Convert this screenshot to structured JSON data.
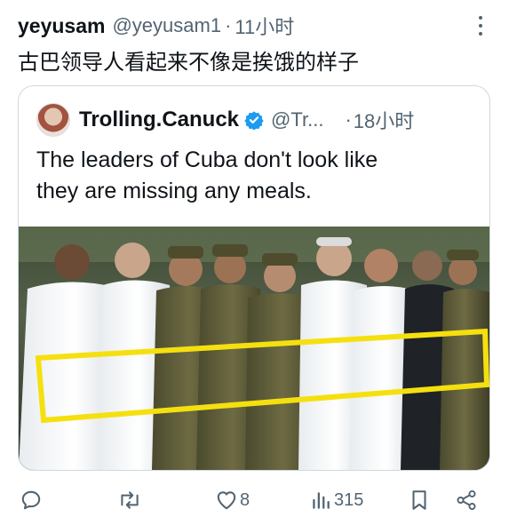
{
  "tweet": {
    "author_name": "yeyusam",
    "author_handle": "@yeyusam1",
    "separator": "·",
    "time": "11小时",
    "text": "古巴领导人看起来不像是挨饿的样子"
  },
  "quote": {
    "author_name": "Trolling.Canuck",
    "author_handle": "@Tr...",
    "separator": "·",
    "time": "18小时",
    "text_lines": [
      "The leaders of Cuba don't look like",
      "they are missing any meals."
    ],
    "highlight_color": "#f5e00f"
  },
  "actions": {
    "reply_icon": "reply-icon",
    "retweet_icon": "retweet-icon",
    "like_icon": "heart-icon",
    "like_count": "8",
    "views_icon": "views-icon",
    "views_count": "315",
    "bookmark_icon": "bookmark-icon",
    "share_icon": "share-icon"
  },
  "colors": {
    "text": "#0f1419",
    "muted": "#536471",
    "border": "#cfd9de",
    "verified": "#1d9bf0"
  }
}
